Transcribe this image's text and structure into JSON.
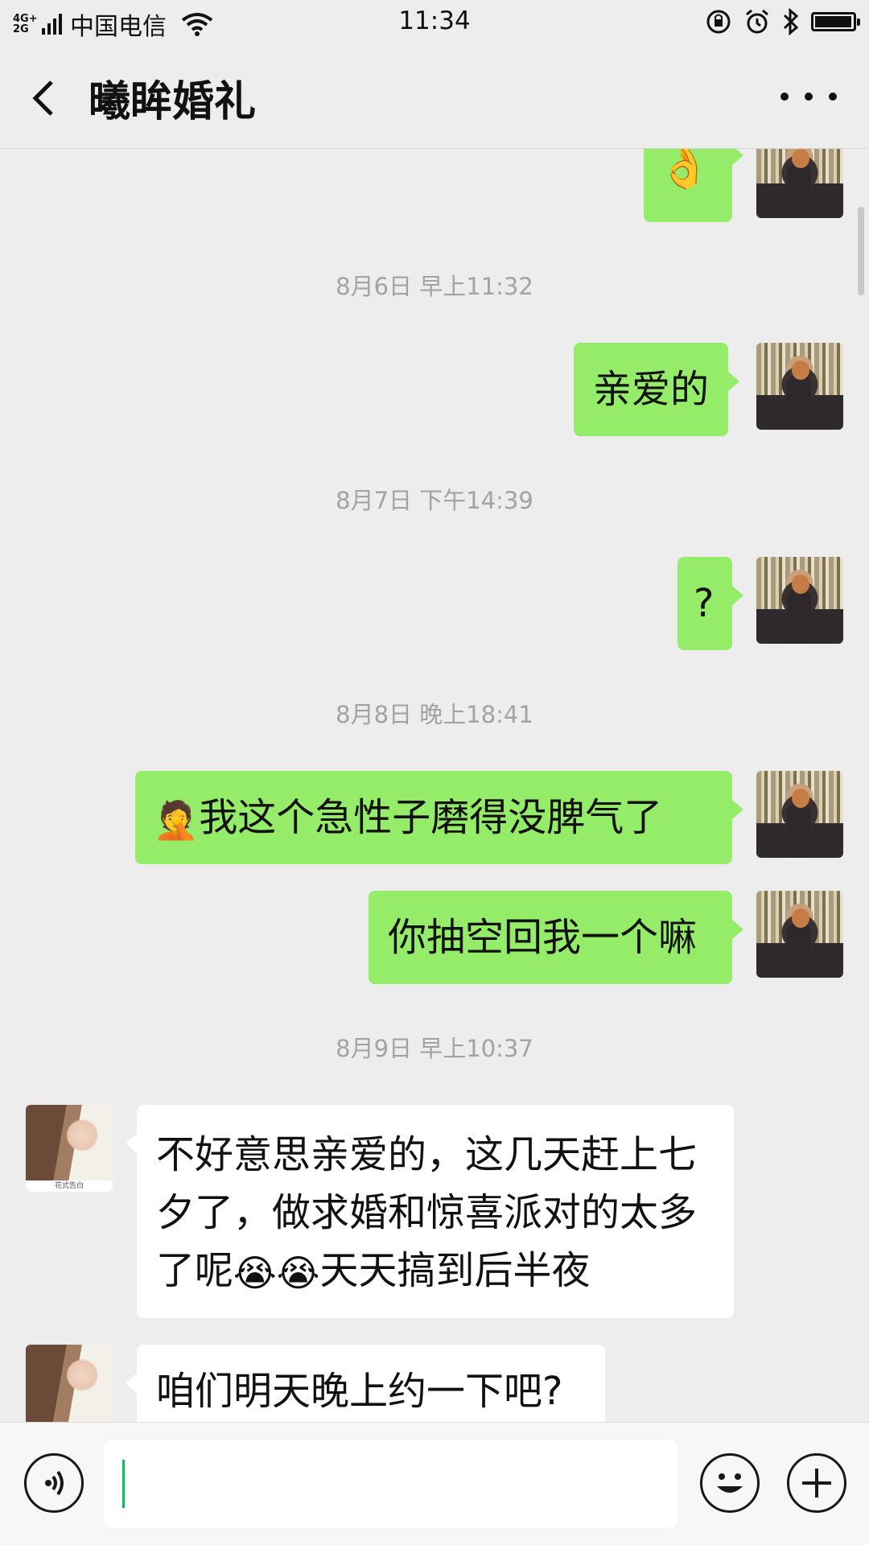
{
  "status_bar": {
    "network": "4G+\n2G",
    "carrier": "中国电信",
    "time": "11:34"
  },
  "header": {
    "title": "曦眸婚礼"
  },
  "messages": [
    {
      "type": "emoji",
      "sender": "me",
      "emoji": "👌"
    },
    {
      "type": "timestamp",
      "text": "8月6日 早上11:32"
    },
    {
      "type": "text",
      "sender": "me",
      "text": "亲爱的"
    },
    {
      "type": "timestamp",
      "text": "8月7日 下午14:39"
    },
    {
      "type": "text",
      "sender": "me",
      "text": "?"
    },
    {
      "type": "timestamp",
      "text": "8月8日 晚上18:41"
    },
    {
      "type": "text",
      "sender": "me",
      "emoji": "🤦",
      "text": "我这个急性子磨得没脾气了"
    },
    {
      "type": "text",
      "sender": "me",
      "text": "你抽空回我一个嘛"
    },
    {
      "type": "timestamp",
      "text": "8月9日 早上10:37"
    },
    {
      "type": "text",
      "sender": "other",
      "lines": [
        "不好意思亲爱的，这几天赶上七",
        "夕了，做求婚和惊喜派对的太多",
        "了呢"
      ],
      "emoji": "😭",
      "tail_text": "天天搞到后半夜"
    },
    {
      "type": "text",
      "sender": "other",
      "text": "咱们明天晚上约一下吧?"
    }
  ],
  "other_avatar_caption": "花式告白",
  "input": {
    "value": ""
  },
  "icons": {
    "back": "back-arrow-icon",
    "more": "more-dots-icon",
    "voice": "voice-icon",
    "emoji": "smiley-icon",
    "plus": "plus-icon"
  },
  "colors": {
    "my_bubble": "#95ec69",
    "other_bubble": "#ffffff",
    "background": "#ededed",
    "caret": "#07c160"
  }
}
